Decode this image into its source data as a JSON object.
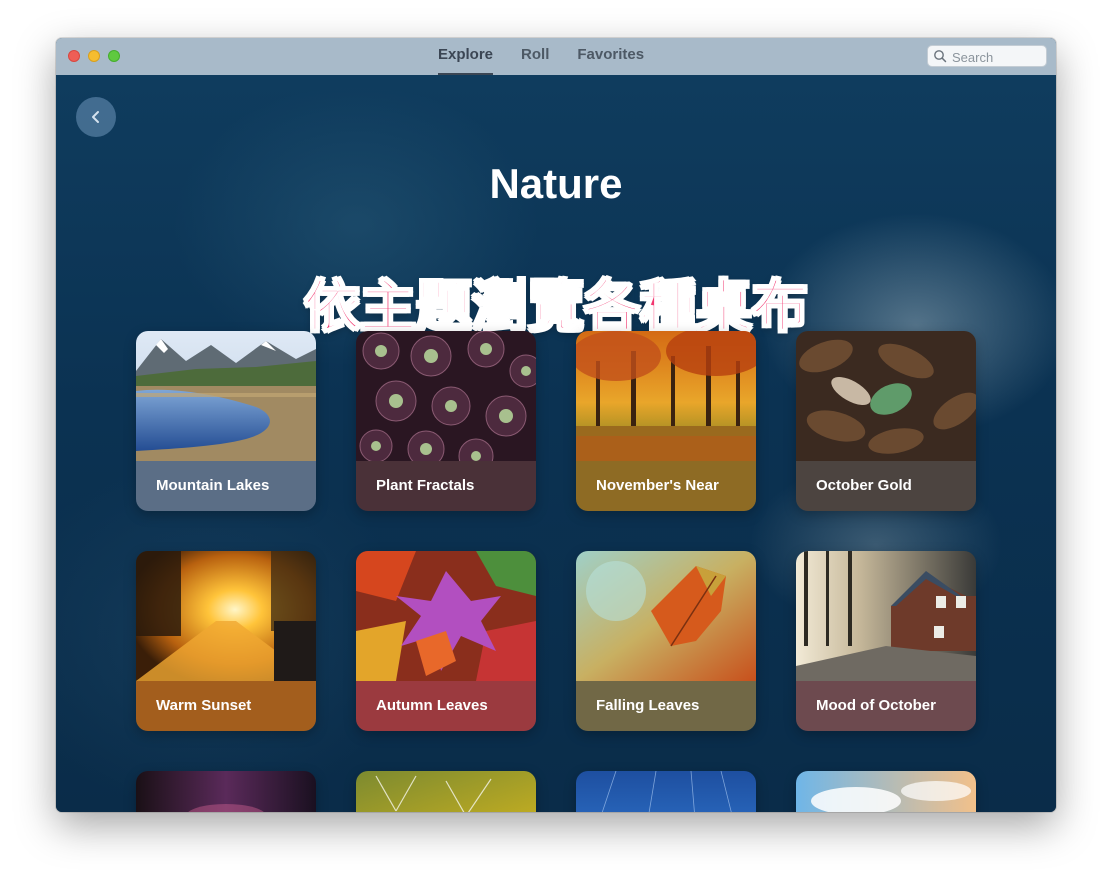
{
  "window": {
    "tabs": [
      {
        "label": "Explore",
        "active": true
      },
      {
        "label": "Roll",
        "active": false
      },
      {
        "label": "Favorites",
        "active": false
      }
    ],
    "search": {
      "placeholder": "Search",
      "value": ""
    }
  },
  "content": {
    "title": "Nature",
    "subtitle": "依主題瀏覽各種桌布"
  },
  "cards": [
    {
      "label": "Mountain Lakes",
      "caption_color": "#5b6e86"
    },
    {
      "label": "Plant Fractals",
      "caption_color": "#4a3138"
    },
    {
      "label": "November's Near",
      "caption_color": "#8e6b24"
    },
    {
      "label": "October Gold",
      "caption_color": "#4c4440"
    },
    {
      "label": "Warm Sunset",
      "caption_color": "#a35e1d"
    },
    {
      "label": "Autumn Leaves",
      "caption_color": "#9b3a3f"
    },
    {
      "label": "Falling Leaves",
      "caption_color": "#716846"
    },
    {
      "label": "Mood of October",
      "caption_color": "#6d4a4f"
    }
  ],
  "colors": {
    "titlebar": "#a8bac9",
    "subtitle": "#f2366f"
  },
  "icons": {
    "back": "chevron-left-icon",
    "search": "magnifying-glass-icon"
  }
}
